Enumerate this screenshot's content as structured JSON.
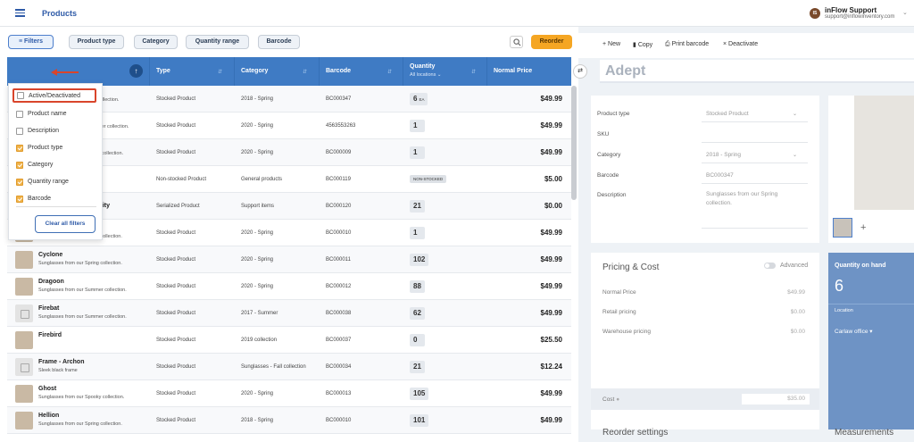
{
  "header": {
    "title": "Products",
    "user_initials": "IS",
    "user_name": "inFlow Support",
    "user_email": "support@inflowinventory.com"
  },
  "toolbar": {
    "filters_label": "Filters",
    "chips": [
      "Product type",
      "Category",
      "Quantity range",
      "Barcode"
    ],
    "reorder_label": "Reorder"
  },
  "table": {
    "columns": {
      "type": "Type",
      "category": "Category",
      "barcode": "Barcode",
      "quantity": "Quantity",
      "quantity_sub": "All locations",
      "price": "Normal Price"
    },
    "rows": [
      {
        "name": "",
        "desc": "collection.",
        "type": "Stocked Product",
        "category": "2018 - Spring",
        "barcode": "BC000347",
        "qty": "6",
        "unit": "EA",
        "price": "$49.99",
        "thumb": true
      },
      {
        "name": "",
        "desc": "mer collection.",
        "type": "Stocked Product",
        "category": "2020 - Spring",
        "barcode": "4563553263",
        "qty": "1",
        "unit": "",
        "price": "$49.99",
        "thumb": true
      },
      {
        "name": "",
        "desc": "g collection.",
        "type": "Stocked Product",
        "category": "2020 - Spring",
        "barcode": "BC000009",
        "qty": "1",
        "unit": "",
        "price": "$49.99",
        "thumb": true
      },
      {
        "name": "",
        "desc": "",
        "type": "Non-stocked Product",
        "category": "General products",
        "barcode": "BC000119",
        "qty": "NON-STOCKED",
        "unit": "",
        "price": "$5.00",
        "thumb": false
      },
      {
        "name": "icity",
        "desc": "",
        "type": "Serialized Product",
        "category": "Support items",
        "barcode": "BC000120",
        "qty": "21",
        "unit": "",
        "price": "$0.00",
        "thumb": false
      },
      {
        "name": "Colossus",
        "desc": "Sunglasses from our Winter collection.",
        "type": "Stocked Product",
        "category": "2020 - Spring",
        "barcode": "BC000010",
        "qty": "1",
        "unit": "",
        "price": "$49.99",
        "thumb": true
      },
      {
        "name": "Cyclone",
        "desc": "Sunglasses from our Spring collection.",
        "type": "Stocked Product",
        "category": "2020 - Spring",
        "barcode": "BC000011",
        "qty": "102",
        "unit": "",
        "price": "$49.99",
        "thumb": true
      },
      {
        "name": "Dragoon",
        "desc": "Sunglasses from our Summer collection.",
        "type": "Stocked Product",
        "category": "2020 - Spring",
        "barcode": "BC000012",
        "qty": "88",
        "unit": "",
        "price": "$49.99",
        "thumb": true
      },
      {
        "name": "Firebat",
        "desc": "Sunglasses from our Summer collection.",
        "type": "Stocked Product",
        "category": "2017 - Summer",
        "barcode": "BC000038",
        "qty": "62",
        "unit": "",
        "price": "$49.99",
        "thumb": "ph"
      },
      {
        "name": "Firebird",
        "desc": "",
        "type": "Stocked Product",
        "category": "2019 collection",
        "barcode": "BC000037",
        "qty": "0",
        "unit": "",
        "price": "$25.50",
        "thumb": true
      },
      {
        "name": "Frame - Archon",
        "desc": "Sleek black frame",
        "type": "Stocked Product",
        "category": "Sunglasses - Fall collection",
        "barcode": "BC000034",
        "qty": "21",
        "unit": "",
        "price": "$12.24",
        "thumb": "ph"
      },
      {
        "name": "Ghost",
        "desc": "Sunglasses from our Spooky collection.",
        "type": "Stocked Product",
        "category": "2020 - Spring",
        "barcode": "BC000013",
        "qty": "105",
        "unit": "",
        "price": "$49.99",
        "thumb": true
      },
      {
        "name": "Hellion",
        "desc": "Sunglasses from our Spring collection.",
        "type": "Stocked Product",
        "category": "2018 - Spring",
        "barcode": "BC000010",
        "qty": "101",
        "unit": "",
        "price": "$49.99",
        "thumb": true
      }
    ]
  },
  "filters_menu": {
    "items": [
      {
        "label": "Active/Deactivated",
        "checked": false
      },
      {
        "label": "Product name",
        "checked": false
      },
      {
        "label": "Description",
        "checked": false
      },
      {
        "label": "Product type",
        "checked": true
      },
      {
        "label": "Category",
        "checked": true
      },
      {
        "label": "Quantity range",
        "checked": true
      },
      {
        "label": "Barcode",
        "checked": true
      }
    ],
    "clear_label": "Clear all filters"
  },
  "detail": {
    "actions": {
      "new": "+ New",
      "copy": "Copy",
      "print": "Print barcode",
      "deactivate": "× Deactivate"
    },
    "name": "Adept",
    "fields": {
      "product_type_label": "Product type",
      "product_type_value": "Stocked Product",
      "sku_label": "SKU",
      "category_label": "Category",
      "category_value": "2018 - Spring",
      "barcode_label": "Barcode",
      "barcode_value": "BC000347",
      "description_label": "Description",
      "description_value": "Sunglasses from our Spring collection."
    },
    "pricing": {
      "title": "Pricing & Cost",
      "advanced_label": "Advanced",
      "normal_label": "Normal Price",
      "normal_value": "$49.99",
      "retail_label": "Retail pricing",
      "retail_value": "$0.00",
      "warehouse_label": "Warehouse pricing",
      "warehouse_value": "$0.00",
      "cost_label": "Cost",
      "cost_value": "$35.00"
    },
    "quantity": {
      "title": "Quantity on hand",
      "value": "6",
      "location_label": "Location",
      "location_value": "Carlaw office ▾"
    },
    "reorder_title": "Reorder settings",
    "measurements_title": "Measurements"
  },
  "colors": {
    "accent": "#2e5aa7",
    "header_blue": "#3f7bc4",
    "reorder": "#f5a623",
    "highlight_red": "#d9452b",
    "checkbox_on": "#f0b34a"
  },
  "icons": [
    "hamburger-icon",
    "search-icon",
    "sort-up-icon",
    "copy-icon",
    "print-icon",
    "collapse-icon",
    "chevron-down-icon",
    "add-icon",
    "info-icon"
  ]
}
